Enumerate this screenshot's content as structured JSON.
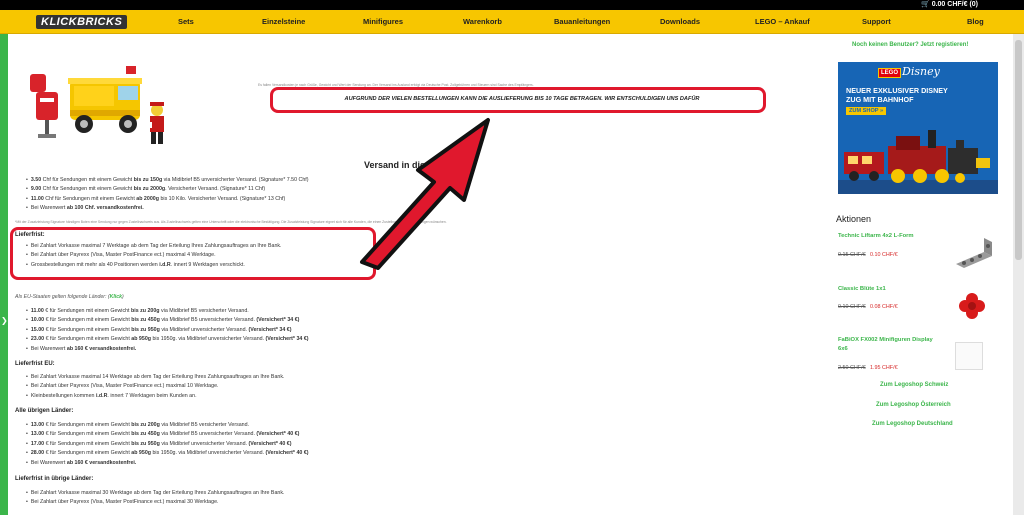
{
  "header": {
    "logo_text": "KLICKBRICKS",
    "cart": "0.00 CHF/€ (0)"
  },
  "nav": {
    "items": [
      {
        "label": "Sets"
      },
      {
        "label": "Einzelsteine"
      },
      {
        "label": "Minifigures"
      },
      {
        "label": "Warenkorb"
      },
      {
        "label": "Bauanleitungen"
      },
      {
        "label": "Downloads"
      },
      {
        "label": "LEGO – Ankauf"
      },
      {
        "label": "Support"
      },
      {
        "label": "Blog"
      }
    ]
  },
  "main": {
    "notice_small": "Es fallen Versandkosten je nach Größe, Gewicht und Wert der Sendung an. Der Versand ins Ausland erfolgt via Deutsche Post. Zollgebühren und Steuern sind Sache des Empfängers.",
    "notice_banner": "AUFGRUND DER VIELEN BESTELLUNGEN KANN DIE AUSLIEFERUNG BIS 10 TAGE BETRAGEN. WIR ENTSCHULDIGEN UNS DAFÜR",
    "section_title": "Versand in die Schweiz",
    "ch_items": [
      {
        "p1": "3.50",
        "p2": " Chf für Sendungen mit einem Gewicht ",
        "b": "bis zu 150g",
        "p3": " via Midibrief B5 unversicherter Versand. (Signature* 7.50 Chf)"
      },
      {
        "p1": "9.00",
        "p2": " Chf für Sendungen mit einem Gewicht ",
        "b": "bis zu 2000g",
        "p3": ". Versicherter Versand. (Signature* 11 Chf)"
      },
      {
        "p1": "11.00",
        "p2": " Chf für Sendungen mit einem Gewicht ",
        "b": "ab 2000g",
        "p3": " bis 10 Kilo. Versicherter Versand. (Signature* 13 Chf)"
      }
    ],
    "ch_free_pre": "Bei Warenwert ",
    "ch_free_b": "ab 100 Chf. versandkostenfrei.",
    "footnote": "*Mit der Zusatzleistung Signature händigen Boten eine Sendung nur gegen Zustellnachweis aus. Als Zustellnachweis gelten eine Unterschrift oder die elektronische Bestätigung. Die Zusatzleistung Signature eignet sich für alle Kunden, die einen Zustellnachweis für Sendungen wünschen.",
    "lieferfrist_label": "Lieferfrist:",
    "lieferfrist_items": [
      "Bei Zahlart Vorkasse maximal 7 Werktage ab dem Tag der Erteilung Ihres Zahlungsauftrages an Ihre Bank.",
      "Bei Zahlart über Payrexx (Visa, Master PostFinance ect.) maximal 4 Werktage."
    ],
    "gross_pre": "Grossbestellungen mit mehr als 40 Positionen werden ",
    "gross_b": "i.d.R",
    "gross_post": ". innert 9 Werktagen verschickt.",
    "eu_countries_pre": "Als EU-Staaten gelten folgende Länder: (",
    "eu_countries_link": "Klick",
    "eu_countries_post": ")",
    "eu_items": [
      {
        "p1": "11.00",
        "p2": " € für Sendungen mit einem Gewicht ",
        "b": "bis zu 200g",
        "p3": " via Midibrief B5 versicherter Versand.",
        "b2": ""
      },
      {
        "p1": "10.00",
        "p2": " € für Sendungen mit einem Gewicht ",
        "b": "bis zu 450g",
        "p3": " via Midibrief B5 unversicherter Versand. ",
        "b2": "(Versichert* 34 €)"
      },
      {
        "p1": "15.00",
        "p2": " € für Sendungen mit einem Gewicht ",
        "b": "bis zu 950g",
        "p3": " via Midibrief unversicherter Versand. ",
        "b2": "(Versichert* 34 €)"
      },
      {
        "p1": "23.00",
        "p2": " € für Sendungen mit einem Gewicht ",
        "b": "ab 950g",
        "p3": " bis 1950g. via Midibrief unversicherter Versand. ",
        "b2": "(Versichert* 34 €)"
      }
    ],
    "eu_free_pre": "Bei Warenwert ",
    "eu_free_b": "ab 160 € versandkostenfrei.",
    "lieferfrist_eu_label": "Lieferfrist EU:",
    "lieferfrist_eu_items": [
      "Bei Zahlart Vorkasse maximal 14 Werktage ab dem Tag der Erteilung Ihres Zahlungsauftrages an Ihre Bank.",
      "Bei Zahlart über Payrexx (Visa, Master PostFinance ect.) maximal 10 Werktage."
    ],
    "klein_pre": "Kleinbestellungen kommen ",
    "klein_b": "i.d.R",
    "klein_post": ". innert 7 Werktagen beim Kunden an.",
    "others_label": "Alle übrigen Länder:",
    "other_items": [
      {
        "p1": "13.00",
        "p2": " € für Sendungen mit einem Gewicht ",
        "b": "bis zu 200g",
        "p3": " via Midibrief B5 versicherter Versand.",
        "b2": ""
      },
      {
        "p1": "13.00",
        "p2": " € für Sendungen mit einem Gewicht ",
        "b": "bis zu 450g",
        "p3": " via Midibrief B5 unversicherter Versand. ",
        "b2": "(Versichert* 40 €)"
      },
      {
        "p1": "17.00",
        "p2": " € für Sendungen mit einem Gewicht ",
        "b": "bis zu 950g",
        "p3": " via Midibrief unversicherter Versand. ",
        "b2": "(Versichert* 40 €)"
      },
      {
        "p1": "28.00",
        "p2": " € für Sendungen mit einem Gewicht ",
        "b": "ab 950g",
        "p3": " bis 1950g. via Midibrief unversicherter Versand. ",
        "b2": "(Versichert* 40 €)"
      }
    ],
    "others_free_pre": "Bei Warenwert ",
    "others_free_b": "ab 160 € versandkostenfrei.",
    "lieferfrist_others_label": "Lieferfrist in übrige Länder:",
    "lieferfrist_others_items": [
      "Bei Zahlart Vorkasse maximal 30 Werktage ab dem Tag der Erteilung Ihres Zahlungsauftrages an Ihre Bank.",
      "Bei Zahlart über Payrexx (Visa, Master PostFinance ect.) maximal 30 Werktage."
    ]
  },
  "sidebar": {
    "register_link": "Noch keinen Benutzer? Jetzt registieren!",
    "promo": {
      "brand1": "LEGO",
      "brand2": "Disney",
      "headline1": "NEUER EXKLUSIVER DISNEY",
      "headline2": "ZUG MIT BAHNHOF",
      "cta": "ZUM SHOP »"
    },
    "aktionen_title": "Aktionen",
    "deals": [
      {
        "name": "Technic Liftarm 4x2 L-Form",
        "old": "0.15 CHF/€",
        "new": "0.10 CHF/€"
      },
      {
        "name": "Classic Blüte 1x1",
        "old": "0.10 CHF/€",
        "new": "0.08 CHF/€"
      },
      {
        "name": "FaBiOX FX002 Minifiguren Display",
        "name2": "6x6",
        "old": "2.50 CHF/€",
        "new": "1.95 CHF/€"
      }
    ],
    "shop_links": [
      "Zum Legoshop Schweiz",
      "Zum Legoshop Österreich",
      "Zum Legoshop Deutschland"
    ]
  },
  "colors": {
    "nav_bg": "#f7c600",
    "accent_green": "#3bb54a",
    "highlight_red": "#e0182d"
  }
}
